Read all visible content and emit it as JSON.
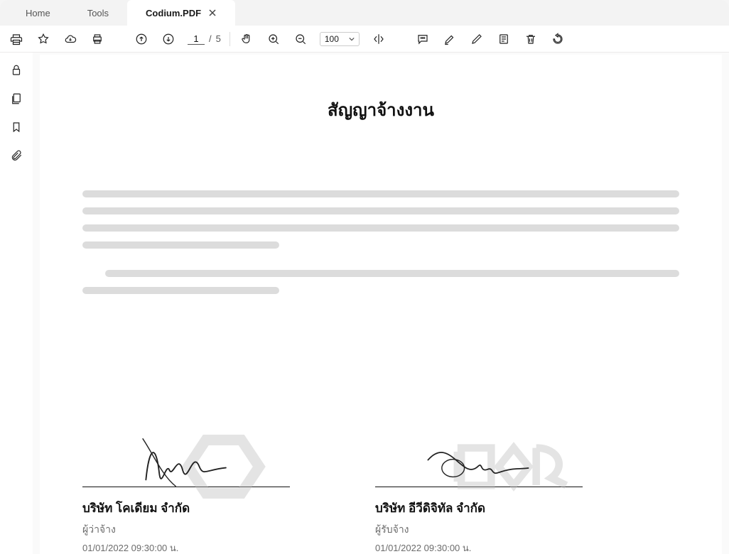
{
  "tabs": [
    {
      "label": "Home",
      "active": false
    },
    {
      "label": "Tools",
      "active": false
    },
    {
      "label": "Codium.PDF",
      "active": true,
      "closable": true
    }
  ],
  "toolbar": {
    "page_current": "1",
    "page_sep": "/",
    "page_total": "5",
    "zoom_value": "100"
  },
  "document": {
    "title": "สัญญาจ้างงาน",
    "signatures": [
      {
        "name": "บริษัท โคเดียม จำกัด",
        "role": "ผู้ว่าจ้าง",
        "timestamp": "01/01/2022 09:30:00 น."
      },
      {
        "name": "บริษัท อีวีดิจิทัล จำกัด",
        "role": "ผู้รับจ้าง",
        "timestamp": "01/01/2022 09:30:00 น."
      }
    ]
  }
}
